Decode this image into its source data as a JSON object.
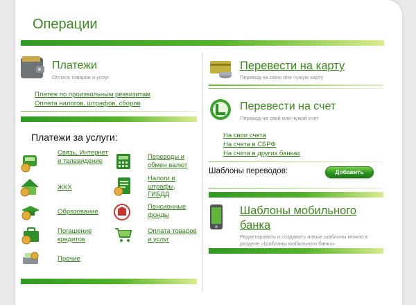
{
  "page": {
    "title": "Операции"
  },
  "left": {
    "payments": {
      "title": "Платежи",
      "subtitle": "Оплата товаров и услуг",
      "links": [
        "Платеж по произвольным реквизитам",
        "Оплата налогов, штрафов, сборов"
      ]
    },
    "services": {
      "title": "Платежи за услуги:",
      "items": [
        {
          "label": "Связь, Интернет и телевидение",
          "icon": "phone-icon"
        },
        {
          "label": "Переводы и обмен валют",
          "icon": "calculator-icon"
        },
        {
          "label": "ЖКХ",
          "icon": "house-icon"
        },
        {
          "label": "Налоги и штрафы, ГИБДД",
          "icon": "tax-icon"
        },
        {
          "label": "Образование",
          "icon": "graduation-cap-icon"
        },
        {
          "label": "Пенсионные фонды",
          "icon": "pension-fund-icon"
        },
        {
          "label": "Погашение кредитов",
          "icon": "briefcase-icon"
        },
        {
          "label": "Оплата товаров и услуг",
          "icon": "cart-icon"
        },
        {
          "label": "Прочие",
          "icon": "cash-register-icon"
        }
      ]
    }
  },
  "right": {
    "to_card": {
      "title": "Перевести на карту",
      "subtitle": "Перевод на свою или чужую карту"
    },
    "to_account": {
      "title": "Перевести на счет",
      "subtitle": "Перевод на свой или чужой счет",
      "links": [
        "На свои счета",
        "На счета в СБРФ",
        "На счета в других банках"
      ]
    },
    "templates": {
      "label": "Шаблоны переводов:",
      "add_button": "Добавить"
    },
    "mobile": {
      "title": "Шаблоны мобильного банка",
      "description": "Редактировать и создавать новые шаблоны можно в разделе «Шаблоны мобильного банка»"
    }
  },
  "colors": {
    "accent": "#39891c",
    "link": "#2f7d17",
    "bar_start": "#2f9a23",
    "bar_end": "#d8ec8e"
  }
}
